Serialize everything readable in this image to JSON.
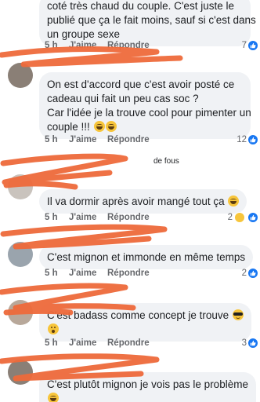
{
  "comments": [
    {
      "lines": [
        "coté très chaud du couple. C'est juste le",
        "publié que ça le fait moins, sauf si c'est dans",
        "un groupe sexe"
      ],
      "time": "5 h",
      "like_label": "J'aime",
      "reply_label": "Répondre",
      "reactions": "7"
    },
    {
      "lines": [
        "On est d'accord que c'est avoir posté ce",
        "cadeau qui fait un peu cas soc ?",
        "Car l'idée je la trouve cool pour pimenter un",
        "couple !!! "
      ],
      "time": "5 h",
      "like_label": "J'aime",
      "reply_label": "Répondre",
      "reactions": "12"
    },
    {
      "author_fragment": "de fous",
      "lines": [
        "Il va dormir après avoir mangé tout ça "
      ],
      "time": "5 h",
      "like_label": "J'aime",
      "reply_label": "Répondre",
      "reactions": "2"
    },
    {
      "lines": [
        "C'est mignon et immonde en même temps"
      ],
      "time": "5 h",
      "like_label": "J'aime",
      "reply_label": "Répondre",
      "reactions": "2"
    },
    {
      "lines": [
        "C'est badass comme concept je trouve "
      ],
      "time": "5 h",
      "like_label": "J'aime",
      "reply_label": "Répondre",
      "reactions": "3"
    },
    {
      "lines": [
        "C'est plutôt mignon je vois pas le problème"
      ]
    }
  ],
  "icons": {
    "like_badge": "thumbs-up-icon",
    "emoji_laugh": "grinning-sweat-emoji",
    "emoji_cool": "sunglasses-emoji",
    "emoji_wow": "astonished-emoji"
  },
  "colors": {
    "bubble": "#f0f2f5",
    "meta": "#65676b",
    "like_blue": "#1877f2",
    "scribble": "#ee6a3b"
  }
}
